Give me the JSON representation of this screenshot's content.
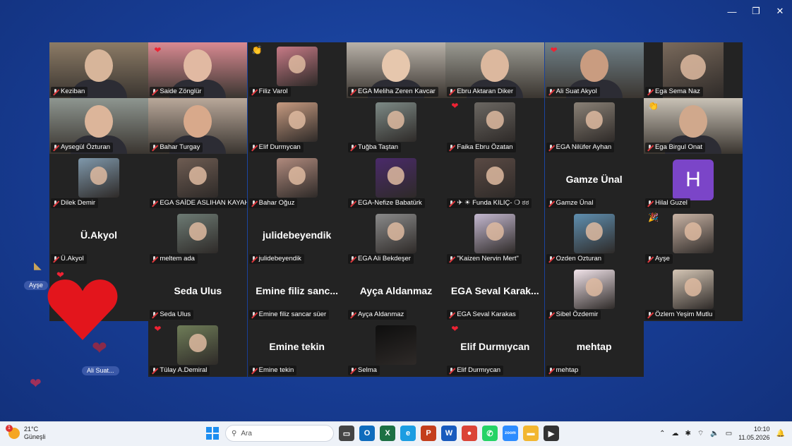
{
  "window": {
    "minimize": "—",
    "restore": "❐",
    "close": "✕"
  },
  "participants": [
    {
      "name": "Keziban",
      "kind": "photo",
      "bg": "#8c7b66",
      "skin": "#d7b59a"
    },
    {
      "name": "Saide Zönglür",
      "kind": "photo",
      "bg": "#d98a92",
      "skin": "#e1b9a2",
      "active": true,
      "reaction": "❤"
    },
    {
      "name": "Filiz Varol",
      "kind": "thumb",
      "bg": "#c77a86",
      "clap": "👏"
    },
    {
      "name": "EGA Meliha Zeren Kavcar",
      "kind": "photo",
      "bg": "#b9b2a9",
      "skin": "#e6c7ad"
    },
    {
      "name": "Ebru Aktaran Diker",
      "kind": "photo",
      "bg": "#9a9a92",
      "skin": "#dcb89e"
    },
    {
      "name": "Ali Suat Akyol",
      "kind": "photo",
      "bg": "#6f8088",
      "skin": "#c99c80",
      "reaction": "❤"
    },
    {
      "name": "Ega Sema Naz",
      "kind": "thumb-full",
      "bg": "#7a6a5c"
    },
    {
      "name": "Aysegül Özturan",
      "kind": "photo",
      "bg": "#8e9690",
      "skin": "#dcb59a"
    },
    {
      "name": "Bahar Turgay",
      "kind": "photo",
      "bg": "#b9a89a",
      "skin": "#d8a98b"
    },
    {
      "name": "Elif Durmуcan",
      "kind": "thumb",
      "bg": "#c69a80"
    },
    {
      "name": "Tuğba Taştan",
      "kind": "thumb",
      "bg": "#7d8a86"
    },
    {
      "name": "Faika Ebru Özatan",
      "kind": "thumb",
      "bg": "#6b6762",
      "reaction": "❤"
    },
    {
      "name": "EGA Nilüfer Ayhan",
      "kind": "thumb",
      "bg": "#8a8176"
    },
    {
      "name": "Ega Birgul Onat",
      "kind": "photo",
      "bg": "#c9c2b6",
      "skin": "#d0a88c",
      "clap": "👏"
    },
    {
      "name": "Dilek Demir",
      "kind": "thumb",
      "bg": "#7f98ab"
    },
    {
      "name": "EGA SAİDE ASLIHAN KAYAH...",
      "kind": "thumb",
      "bg": "#6e5c52"
    },
    {
      "name": "Bahar Oğuz",
      "kind": "thumb",
      "bg": "#b08a7d"
    },
    {
      "name": "EGA-Nefize Babatürk",
      "kind": "thumb",
      "bg": "#4a2a6a"
    },
    {
      "name": "✈ ☀ Funda KILIÇ- ❍ ಠಠ",
      "kind": "thumb",
      "bg": "#5a4a44"
    },
    {
      "name": "Gamze Ünal",
      "kind": "name",
      "display": "Gamze Ünal"
    },
    {
      "name": "Hilal Guzel",
      "kind": "letter",
      "letter": "H"
    },
    {
      "name": "Ü.Akyol",
      "kind": "name",
      "display": "Ü.Akyol"
    },
    {
      "name": "meltem ada",
      "kind": "thumb",
      "bg": "#6d7b74"
    },
    {
      "name": "julidebeyendik",
      "kind": "name",
      "display": "julidebeyendik"
    },
    {
      "name": "EGA  Ali  Bekdeşer",
      "kind": "thumb",
      "bg": "#8a8a8a"
    },
    {
      "name": "\"Kaizen Nervin Mert\"",
      "kind": "thumb",
      "bg": "#c4b8d0"
    },
    {
      "name": "Ozden Ozturan",
      "kind": "thumb",
      "bg": "#5f8fb0"
    },
    {
      "name": "Ayşe",
      "kind": "thumb",
      "bg": "#c9b3a4",
      "clap": "🎉"
    },
    {
      "name": "",
      "kind": "empty"
    },
    {
      "name": "Seda Ulus",
      "kind": "name",
      "display": "Seda Ulus"
    },
    {
      "name": "Emine filiz sancar süer",
      "kind": "name",
      "display": "Emine  filiz  sanc..."
    },
    {
      "name": "Ayça Aldanmaz",
      "kind": "name",
      "display": "Ayça Aldanmaz"
    },
    {
      "name": "EGA Seval Karakas",
      "kind": "name",
      "display": "EGA  Seval  Karak..."
    },
    {
      "name": "Sibel Özdemir",
      "kind": "thumb",
      "bg": "#f2e4ea"
    },
    {
      "name": "Özlem Yeşim Mutlu",
      "kind": "thumb",
      "bg": "#d5c6b5"
    },
    {
      "name": "",
      "kind": "gap"
    },
    {
      "name": "Tülay A.Demiral",
      "kind": "thumb",
      "bg": "#6f7d58",
      "reaction": "❤"
    },
    {
      "name": "Emine tekin",
      "kind": "name",
      "display": "Emine tekin"
    },
    {
      "name": "Selma",
      "kind": "thumb",
      "bg": "#0e0e0e"
    },
    {
      "name": "Elif Durmıycan",
      "kind": "name",
      "display": "Elif Durmıycan",
      "reaction": "❤"
    },
    {
      "name": "mehtap",
      "kind": "name",
      "display": "mehtap"
    }
  ],
  "floating": {
    "ayse_bubble": "Ayşe",
    "ali_bubble": "Ali Suat..."
  },
  "taskbar": {
    "weather_temp": "21°C",
    "weather_desc": "Güneşli",
    "weather_badge": "1",
    "search_placeholder": "Ara",
    "apps": [
      {
        "name": "task-view",
        "label": "▭",
        "color": "#444"
      },
      {
        "name": "outlook",
        "label": "O",
        "color": "#0f6cbd"
      },
      {
        "name": "excel",
        "label": "X",
        "color": "#1d7044"
      },
      {
        "name": "edge",
        "label": "e",
        "color": "#1b9de2"
      },
      {
        "name": "powerpoint",
        "label": "P",
        "color": "#c43e1c"
      },
      {
        "name": "word",
        "label": "W",
        "color": "#185abd"
      },
      {
        "name": "chrome",
        "label": "●",
        "color": "#db4437"
      },
      {
        "name": "whatsapp",
        "label": "✆",
        "color": "#25d366"
      },
      {
        "name": "zoom",
        "label": "zoom",
        "color": "#2d8cff"
      },
      {
        "name": "file-explorer",
        "label": "▬",
        "color": "#f2b630"
      },
      {
        "name": "media-player",
        "label": "▶",
        "color": "#333"
      }
    ],
    "time": "10:10",
    "date": "11.05.2026"
  }
}
